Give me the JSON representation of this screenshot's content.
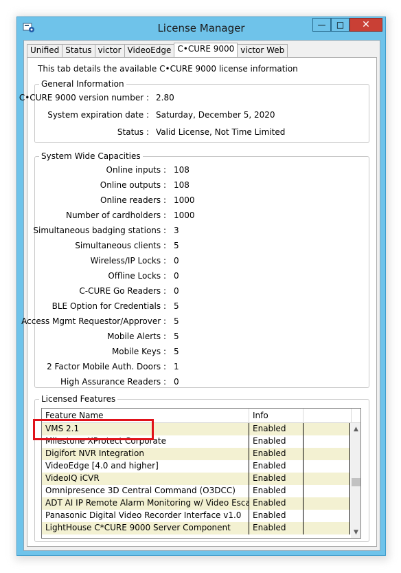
{
  "window": {
    "title": "License Manager",
    "buttons": {
      "minimize": "—",
      "maximize": "□",
      "close": "✕"
    }
  },
  "tabs": [
    {
      "label": "Unified"
    },
    {
      "label": "Status"
    },
    {
      "label": "victor"
    },
    {
      "label": "VideoEdge"
    },
    {
      "label": "C•CURE 9000",
      "active": true
    },
    {
      "label": "victor Web"
    }
  ],
  "intro": "This tab details the available C•CURE 9000 license information",
  "general": {
    "legend": "General Information",
    "version_label": "C•CURE 9000 version number :",
    "version_value": "2.80",
    "expiration_label": "System expiration date :",
    "expiration_value": "Saturday, December 5, 2020",
    "status_label": "Status :",
    "status_value": "Valid License, Not Time Limited"
  },
  "capacities": {
    "legend": "System Wide Capacities",
    "items": [
      {
        "label": "Online inputs :",
        "value": "108"
      },
      {
        "label": "Online outputs :",
        "value": "108"
      },
      {
        "label": "Online readers :",
        "value": "1000"
      },
      {
        "label": "Number of cardholders :",
        "value": "1000"
      },
      {
        "label": "Simultaneous badging stations :",
        "value": "3"
      },
      {
        "label": "Simultaneous clients :",
        "value": "5"
      },
      {
        "label": "Wireless/IP Locks :",
        "value": "0"
      },
      {
        "label": "Offline Locks :",
        "value": "0"
      },
      {
        "label": "C-CURE Go Readers :",
        "value": "0"
      },
      {
        "label": "BLE Option for Credentials :",
        "value": "5"
      },
      {
        "label": "Access Mgmt Requestor/Approver :",
        "value": "5"
      },
      {
        "label": "Mobile Alerts :",
        "value": "5"
      },
      {
        "label": "Mobile Keys :",
        "value": "5"
      },
      {
        "label": "2 Factor Mobile Auth. Doors :",
        "value": "1"
      },
      {
        "label": "High Assurance Readers :",
        "value": "0"
      }
    ]
  },
  "features": {
    "legend": "Licensed Features",
    "columns": [
      "Feature Name",
      "Info"
    ],
    "rows": [
      {
        "name": "VMS 2.1",
        "info": "Enabled"
      },
      {
        "name": "Milestone XProtect Corporate",
        "info": "Enabled"
      },
      {
        "name": "Digifort NVR Integration",
        "info": "Enabled"
      },
      {
        "name": "VideoEdge [4.0 and higher]",
        "info": "Enabled"
      },
      {
        "name": "VideoIQ iCVR",
        "info": "Enabled"
      },
      {
        "name": "Omnipresence 3D Central Command (O3DCC)",
        "info": "Enabled"
      },
      {
        "name": "ADT AI IP Remote Alarm Monitoring w/ Video Escalation",
        "info": "Enabled"
      },
      {
        "name": "Panasonic Digital Video Recorder Interface v1.0",
        "info": "Enabled"
      },
      {
        "name": "LightHouse C*CURE 9000 Server Component",
        "info": "Enabled"
      }
    ]
  },
  "colors": {
    "window_frame": "#6fc3ea",
    "highlight_box": "#e0121a",
    "row_alt": "#f3f1d2"
  }
}
